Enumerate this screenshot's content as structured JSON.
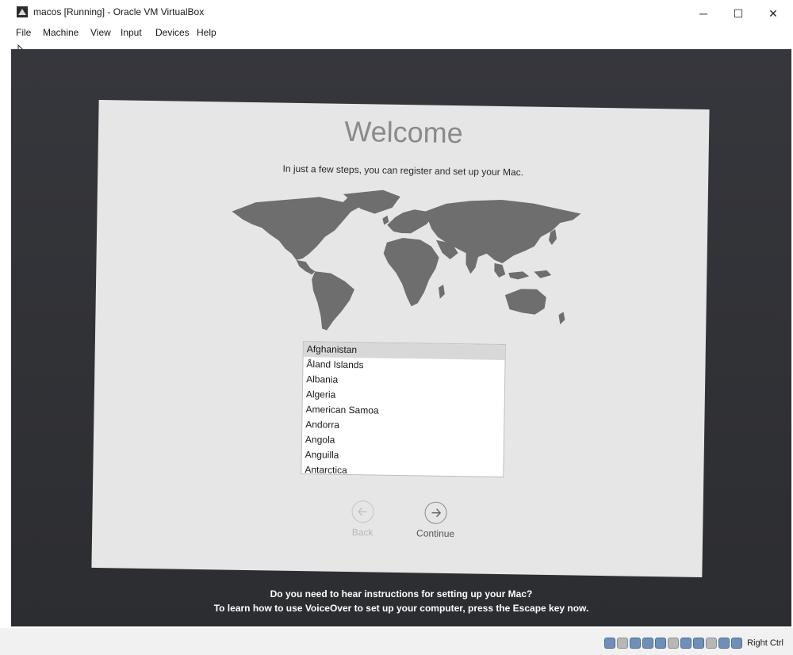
{
  "window": {
    "title": "macos [Running] - Oracle VM VirtualBox",
    "controls": {
      "minimize": "─",
      "maximize": "☐",
      "close": "✕"
    }
  },
  "menubar": {
    "items": [
      "File",
      "Machine",
      "View",
      "Input",
      "Devices",
      "Help"
    ]
  },
  "setup": {
    "title": "Welcome",
    "subtitle": "In just a few steps, you can register and set up your Mac.",
    "countries": [
      "Afghanistan",
      "Åland Islands",
      "Albania",
      "Algeria",
      "American Samoa",
      "Andorra",
      "Angola",
      "Anguilla",
      "Antarctica"
    ],
    "selected_country": "Afghanistan",
    "back_label": "Back",
    "continue_label": "Continue"
  },
  "voiceover": {
    "line1": "Do you need to hear instructions for setting up your Mac?",
    "line2": "To learn how to use VoiceOver to set up your computer, press the Escape key now."
  },
  "statusbar": {
    "host_key": "Right Ctrl"
  },
  "colors": {
    "vm_background": "#333438",
    "panel": "#e6e6e6",
    "map_land": "#6e6e6e"
  }
}
